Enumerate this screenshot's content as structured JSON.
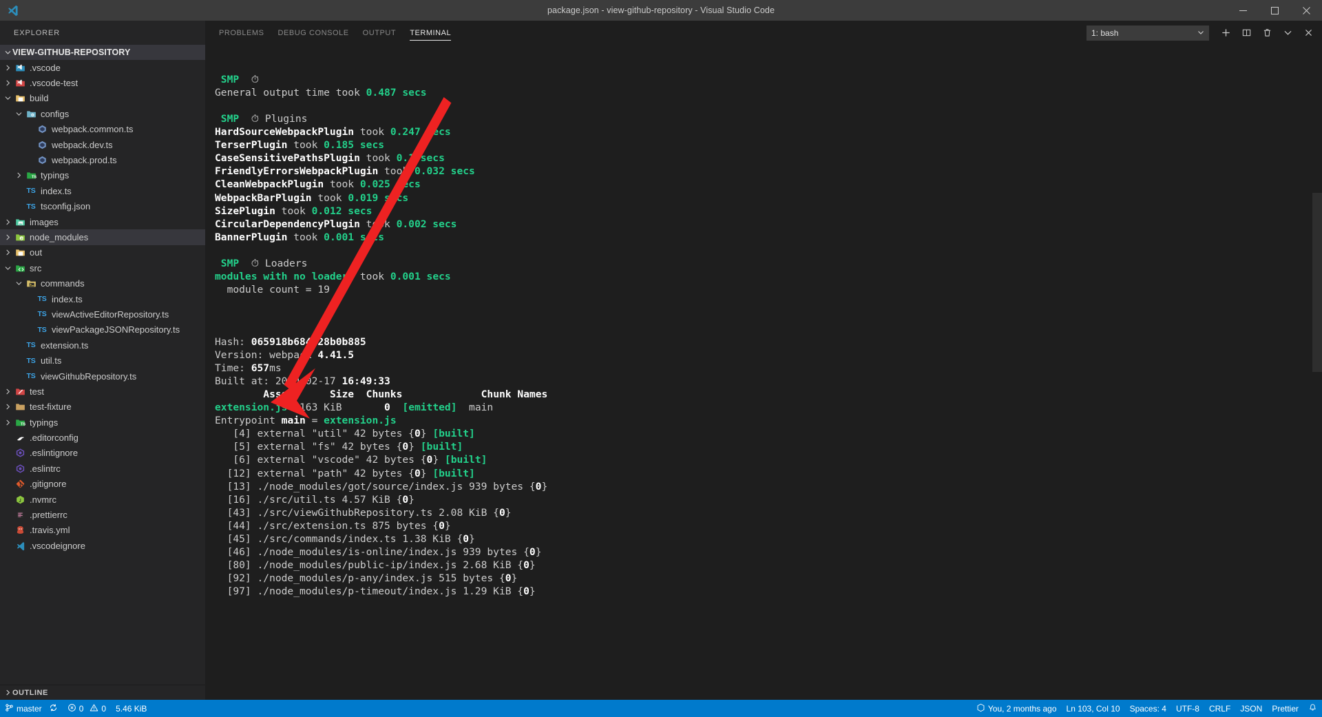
{
  "window": {
    "title": "package.json - view-github-repository - Visual Studio Code",
    "logo_icon": "vscode-logo-icon",
    "minimize_label": "Minimize",
    "maximize_label": "Restore",
    "close_label": "Close"
  },
  "sidebar": {
    "header": "EXPLORER",
    "root": "VIEW-GITHUB-REPOSITORY",
    "outline": "OUTLINE",
    "items": [
      {
        "label": ".vscode",
        "indent": 1,
        "arrow": "right",
        "icon": "vscode-folder-icon",
        "color": "#2c8ebb",
        "selected": false
      },
      {
        "label": ".vscode-test",
        "indent": 1,
        "arrow": "right",
        "icon": "vscode-test-folder-icon",
        "color": "#d14545",
        "selected": false
      },
      {
        "label": "build",
        "indent": 1,
        "arrow": "down",
        "icon": "build-folder-icon",
        "color": "#e8c06a",
        "selected": false
      },
      {
        "label": "configs",
        "indent": 2,
        "arrow": "down",
        "icon": "config-folder-icon",
        "color": "#6fb3c9",
        "selected": false
      },
      {
        "label": "webpack.common.ts",
        "indent": 3,
        "arrow": "none",
        "icon": "webpack-file-icon",
        "color": "#6c90c9",
        "selected": false
      },
      {
        "label": "webpack.dev.ts",
        "indent": 3,
        "arrow": "none",
        "icon": "webpack-file-icon",
        "color": "#6c90c9",
        "selected": false
      },
      {
        "label": "webpack.prod.ts",
        "indent": 3,
        "arrow": "none",
        "icon": "webpack-file-icon",
        "color": "#6c90c9",
        "selected": false
      },
      {
        "label": "typings",
        "indent": 2,
        "arrow": "right",
        "icon": "typescript-folder-icon",
        "color": "#2aa745",
        "selected": false
      },
      {
        "label": "index.ts",
        "indent": 2,
        "arrow": "none",
        "icon": "typescript-file-icon",
        "color": "#3da5e8",
        "selected": false
      },
      {
        "label": "tsconfig.json",
        "indent": 2,
        "arrow": "none",
        "icon": "tsconfig-file-icon",
        "color": "#3da5e8",
        "selected": false
      },
      {
        "label": "images",
        "indent": 1,
        "arrow": "right",
        "icon": "images-folder-icon",
        "color": "#4ec9a0",
        "selected": false
      },
      {
        "label": "node_modules",
        "indent": 1,
        "arrow": "right",
        "icon": "node-modules-folder-icon",
        "color": "#8dc63f",
        "selected": true
      },
      {
        "label": "out",
        "indent": 1,
        "arrow": "right",
        "icon": "out-folder-icon",
        "color": "#e8c06a",
        "selected": false
      },
      {
        "label": "src",
        "indent": 1,
        "arrow": "down",
        "icon": "src-folder-icon",
        "color": "#2aa745",
        "selected": false
      },
      {
        "label": "commands",
        "indent": 2,
        "arrow": "down",
        "icon": "commands-folder-icon",
        "color": "#d8c06a",
        "selected": false
      },
      {
        "label": "index.ts",
        "indent": 3,
        "arrow": "none",
        "icon": "typescript-file-icon",
        "color": "#3da5e8",
        "selected": false
      },
      {
        "label": "viewActiveEditorRepository.ts",
        "indent": 3,
        "arrow": "none",
        "icon": "typescript-file-icon",
        "color": "#3da5e8",
        "selected": false
      },
      {
        "label": "viewPackageJSONRepository.ts",
        "indent": 3,
        "arrow": "none",
        "icon": "typescript-file-icon",
        "color": "#3da5e8",
        "selected": false
      },
      {
        "label": "extension.ts",
        "indent": 2,
        "arrow": "none",
        "icon": "typescript-file-icon",
        "color": "#3da5e8",
        "selected": false
      },
      {
        "label": "util.ts",
        "indent": 2,
        "arrow": "none",
        "icon": "typescript-file-icon",
        "color": "#3da5e8",
        "selected": false
      },
      {
        "label": "viewGithubRepository.ts",
        "indent": 2,
        "arrow": "none",
        "icon": "typescript-file-icon",
        "color": "#3da5e8",
        "selected": false
      },
      {
        "label": "test",
        "indent": 1,
        "arrow": "right",
        "icon": "test-folder-icon",
        "color": "#d14545",
        "selected": false
      },
      {
        "label": "test-fixture",
        "indent": 1,
        "arrow": "right",
        "icon": "plain-folder-icon",
        "color": "#c8a060",
        "selected": false
      },
      {
        "label": "typings",
        "indent": 1,
        "arrow": "right",
        "icon": "typescript-folder-icon",
        "color": "#2aa745",
        "selected": false
      },
      {
        "label": ".editorconfig",
        "indent": 1,
        "arrow": "none",
        "icon": "editorconfig-file-icon",
        "color": "#e8e8e8",
        "selected": false
      },
      {
        "label": ".eslintignore",
        "indent": 1,
        "arrow": "none",
        "icon": "eslint-file-icon",
        "color": "#6b4fbb",
        "selected": false
      },
      {
        "label": ".eslintrc",
        "indent": 1,
        "arrow": "none",
        "icon": "eslint-file-icon",
        "color": "#6b4fbb",
        "selected": false
      },
      {
        "label": ".gitignore",
        "indent": 1,
        "arrow": "none",
        "icon": "git-file-icon",
        "color": "#e05a2b",
        "selected": false
      },
      {
        "label": ".nvmrc",
        "indent": 1,
        "arrow": "none",
        "icon": "nodejs-file-icon",
        "color": "#8dc63f",
        "selected": false
      },
      {
        "label": ".prettierrc",
        "indent": 1,
        "arrow": "none",
        "icon": "prettier-file-icon",
        "color": "#c77ca0",
        "selected": false
      },
      {
        "label": ".travis.yml",
        "indent": 1,
        "arrow": "none",
        "icon": "travis-file-icon",
        "color": "#cb4b36",
        "selected": false
      },
      {
        "label": ".vscodeignore",
        "indent": 1,
        "arrow": "none",
        "icon": "vscode-file-icon",
        "color": "#2c8ebb",
        "selected": false
      }
    ]
  },
  "panel": {
    "tabs": [
      {
        "label": "PROBLEMS",
        "active": false
      },
      {
        "label": "DEBUG CONSOLE",
        "active": false
      },
      {
        "label": "OUTPUT",
        "active": false
      },
      {
        "label": "TERMINAL",
        "active": true
      }
    ],
    "terminal_select_value": "1: bash",
    "actions": [
      {
        "name": "new-terminal-button",
        "icon": "plus-icon"
      },
      {
        "name": "split-terminal-button",
        "icon": "split-icon"
      },
      {
        "name": "kill-terminal-button",
        "icon": "trash-icon"
      },
      {
        "name": "maximize-panel-button",
        "icon": "chevron-down-icon"
      },
      {
        "name": "close-panel-button",
        "icon": "close-icon"
      }
    ]
  },
  "terminal": {
    "lines": [
      [
        {
          "t": " ",
          "c": "dim"
        },
        {
          "t": "SMP",
          "c": "gb"
        },
        {
          "t": "  ⏱",
          "c": "w"
        }
      ],
      [
        {
          "t": "General output time took ",
          "c": "dim"
        },
        {
          "t": "0.487 secs",
          "c": "gb"
        }
      ],
      [
        {
          "t": "",
          "c": "dim"
        }
      ],
      [
        {
          "t": " ",
          "c": "dim"
        },
        {
          "t": "SMP",
          "c": "gb"
        },
        {
          "t": "  ⏱ ",
          "c": "w"
        },
        {
          "t": "Plugins",
          "c": "dim"
        }
      ],
      [
        {
          "t": "HardSourceWebpackPlugin",
          "c": "wb"
        },
        {
          "t": " took ",
          "c": "dim"
        },
        {
          "t": "0.247 secs",
          "c": "gb"
        }
      ],
      [
        {
          "t": "TerserPlugin",
          "c": "wb"
        },
        {
          "t": " took ",
          "c": "dim"
        },
        {
          "t": "0.185 secs",
          "c": "gb"
        }
      ],
      [
        {
          "t": "CaseSensitivePathsPlugin",
          "c": "wb"
        },
        {
          "t": " took ",
          "c": "dim"
        },
        {
          "t": "0.1 secs",
          "c": "gb"
        }
      ],
      [
        {
          "t": "FriendlyErrorsWebpackPlugin",
          "c": "wb"
        },
        {
          "t": " took ",
          "c": "dim"
        },
        {
          "t": "0.032 secs",
          "c": "gb"
        }
      ],
      [
        {
          "t": "CleanWebpackPlugin",
          "c": "wb"
        },
        {
          "t": " took ",
          "c": "dim"
        },
        {
          "t": "0.025 secs",
          "c": "gb"
        }
      ],
      [
        {
          "t": "WebpackBarPlugin",
          "c": "wb"
        },
        {
          "t": " took ",
          "c": "dim"
        },
        {
          "t": "0.019 secs",
          "c": "gb"
        }
      ],
      [
        {
          "t": "SizePlugin",
          "c": "wb"
        },
        {
          "t": " took ",
          "c": "dim"
        },
        {
          "t": "0.012 secs",
          "c": "gb"
        }
      ],
      [
        {
          "t": "CircularDependencyPlugin",
          "c": "wb"
        },
        {
          "t": " took ",
          "c": "dim"
        },
        {
          "t": "0.002 secs",
          "c": "gb"
        }
      ],
      [
        {
          "t": "BannerPlugin",
          "c": "wb"
        },
        {
          "t": " took ",
          "c": "dim"
        },
        {
          "t": "0.001 secs",
          "c": "gb"
        }
      ],
      [
        {
          "t": "",
          "c": "dim"
        }
      ],
      [
        {
          "t": " ",
          "c": "dim"
        },
        {
          "t": "SMP",
          "c": "gb"
        },
        {
          "t": "  ⏱ ",
          "c": "w"
        },
        {
          "t": "Loaders",
          "c": "dim"
        }
      ],
      [
        {
          "t": "modules with no loaders",
          "c": "gb"
        },
        {
          "t": " took ",
          "c": "dim"
        },
        {
          "t": "0.001 secs",
          "c": "gb"
        }
      ],
      [
        {
          "t": "  module count = 19",
          "c": "dim"
        }
      ],
      [
        {
          "t": "",
          "c": "dim"
        }
      ],
      [
        {
          "t": "",
          "c": "dim"
        }
      ],
      [
        {
          "t": "",
          "c": "dim"
        }
      ],
      [
        {
          "t": "Hash: ",
          "c": "dim"
        },
        {
          "t": "065918b684e28b0b885",
          "c": "wb"
        }
      ],
      [
        {
          "t": "Version: webpack ",
          "c": "dim"
        },
        {
          "t": "4.41.5",
          "c": "wb"
        }
      ],
      [
        {
          "t": "Time: ",
          "c": "dim"
        },
        {
          "t": "657",
          "c": "wb"
        },
        {
          "t": "ms",
          "c": "dim"
        }
      ],
      [
        {
          "t": "Built at: 2020-02-17 ",
          "c": "dim"
        },
        {
          "t": "16:49:33",
          "c": "wb"
        }
      ],
      [
        {
          "t": "        ",
          "c": "dim"
        },
        {
          "t": "Asset      Size  Chunks",
          "c": "wb"
        },
        {
          "t": "             ",
          "c": "dim"
        },
        {
          "t": "Chunk Names",
          "c": "wb"
        }
      ],
      [
        {
          "t": "extension.js",
          "c": "gb"
        },
        {
          "t": "  163 KiB       ",
          "c": "dim"
        },
        {
          "t": "0",
          "c": "wb"
        },
        {
          "t": "  ",
          "c": "dim"
        },
        {
          "t": "[emitted]",
          "c": "gb"
        },
        {
          "t": "  main",
          "c": "dim"
        }
      ],
      [
        {
          "t": "Entrypoint ",
          "c": "dim"
        },
        {
          "t": "main",
          "c": "wb"
        },
        {
          "t": " = ",
          "c": "dim"
        },
        {
          "t": "extension.js",
          "c": "gb"
        }
      ],
      [
        {
          "t": "   [4] external \"util\" 42 bytes {",
          "c": "dim"
        },
        {
          "t": "0",
          "c": "wb"
        },
        {
          "t": "} ",
          "c": "dim"
        },
        {
          "t": "[built]",
          "c": "gb"
        }
      ],
      [
        {
          "t": "   [5] external \"fs\" 42 bytes {",
          "c": "dim"
        },
        {
          "t": "0",
          "c": "wb"
        },
        {
          "t": "} ",
          "c": "dim"
        },
        {
          "t": "[built]",
          "c": "gb"
        }
      ],
      [
        {
          "t": "   [6] external \"vscode\" 42 bytes {",
          "c": "dim"
        },
        {
          "t": "0",
          "c": "wb"
        },
        {
          "t": "} ",
          "c": "dim"
        },
        {
          "t": "[built]",
          "c": "gb"
        }
      ],
      [
        {
          "t": "  [12] external \"path\" 42 bytes {",
          "c": "dim"
        },
        {
          "t": "0",
          "c": "wb"
        },
        {
          "t": "} ",
          "c": "dim"
        },
        {
          "t": "[built]",
          "c": "gb"
        }
      ],
      [
        {
          "t": "  [13] ./node_modules/got/source/index.js 939 bytes {",
          "c": "dim"
        },
        {
          "t": "0",
          "c": "wb"
        },
        {
          "t": "}",
          "c": "dim"
        }
      ],
      [
        {
          "t": "  [16] ./src/util.ts 4.57 KiB {",
          "c": "dim"
        },
        {
          "t": "0",
          "c": "wb"
        },
        {
          "t": "}",
          "c": "dim"
        }
      ],
      [
        {
          "t": "  [43] ./src/viewGithubRepository.ts 2.08 KiB {",
          "c": "dim"
        },
        {
          "t": "0",
          "c": "wb"
        },
        {
          "t": "}",
          "c": "dim"
        }
      ],
      [
        {
          "t": "  [44] ./src/extension.ts 875 bytes {",
          "c": "dim"
        },
        {
          "t": "0",
          "c": "wb"
        },
        {
          "t": "}",
          "c": "dim"
        }
      ],
      [
        {
          "t": "  [45] ./src/commands/index.ts 1.38 KiB {",
          "c": "dim"
        },
        {
          "t": "0",
          "c": "wb"
        },
        {
          "t": "}",
          "c": "dim"
        }
      ],
      [
        {
          "t": "  [46] ./node_modules/is-online/index.js 939 bytes {",
          "c": "dim"
        },
        {
          "t": "0",
          "c": "wb"
        },
        {
          "t": "}",
          "c": "dim"
        }
      ],
      [
        {
          "t": "  [80] ./node_modules/public-ip/index.js 2.68 KiB {",
          "c": "dim"
        },
        {
          "t": "0",
          "c": "wb"
        },
        {
          "t": "}",
          "c": "dim"
        }
      ],
      [
        {
          "t": "  [92] ./node_modules/p-any/index.js 515 bytes {",
          "c": "dim"
        },
        {
          "t": "0",
          "c": "wb"
        },
        {
          "t": "}",
          "c": "dim"
        }
      ],
      [
        {
          "t": "  [97] ./node_modules/p-timeout/index.js 1.29 KiB {",
          "c": "dim"
        },
        {
          "t": "0",
          "c": "wb"
        },
        {
          "t": "}",
          "c": "dim"
        }
      ]
    ]
  },
  "statusbar": {
    "branch": "master",
    "branch_icon": "source-control-icon",
    "sync_icon": "sync-icon",
    "errors": "0",
    "warnings": "0",
    "error_icon": "error-icon",
    "warning_icon": "warning-icon",
    "size": "5.46 KiB",
    "authorship": "You, 2 months ago",
    "authorship_icon": "git-lens-icon",
    "cursor": "Ln 103, Col 10",
    "spaces": "Spaces: 4",
    "encoding": "UTF-8",
    "eol": "CRLF",
    "language": "JSON",
    "formatter": "Prettier",
    "bell_icon": "bell-icon"
  },
  "colors": {
    "accent": "#007acc",
    "titlebar": "#3c3c3c",
    "sidebar": "#252526",
    "editor": "#1e1e1e",
    "terminal_green": "#23d18b",
    "selection": "#37373d",
    "arrow_red": "#ee2222"
  }
}
